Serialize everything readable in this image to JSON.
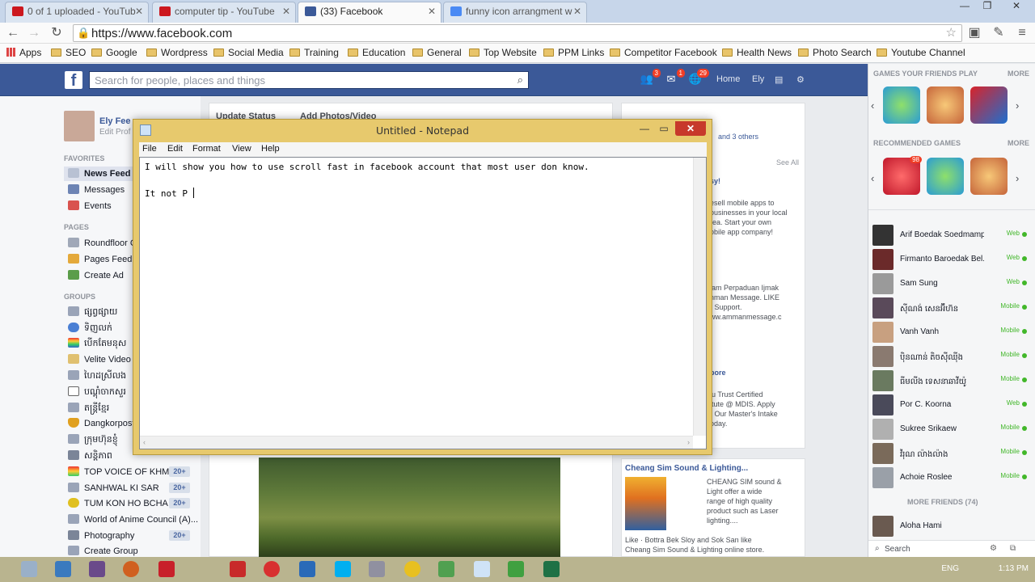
{
  "browser": {
    "tabs": [
      {
        "title": "0 of 1 uploaded - YouTub",
        "color": "#cc181e"
      },
      {
        "title": "computer tip - YouTube",
        "color": "#cc181e"
      },
      {
        "title": "(33) Facebook",
        "color": "#3b5998"
      },
      {
        "title": "funny icon arrangment w",
        "color": "#4a8af4"
      }
    ],
    "url": "https://www.facebook.com",
    "bookmarks": [
      "Apps",
      "SEO",
      "Google",
      "Wordpress",
      "Social Media",
      "Training",
      "Education",
      "General",
      "Top Website",
      "PPM Links",
      "Competitor Facebook",
      "Health News",
      "Photo Search",
      "Youtube Channel"
    ]
  },
  "facebook": {
    "search_placeholder": "Search for people, places and things",
    "badges": {
      "friends": "3",
      "messages": "1",
      "notifications": "29"
    },
    "top_links": [
      "Home",
      "Ely"
    ],
    "profile": {
      "name": "Ely Fee",
      "edit": "Edit Prof"
    },
    "sections": {
      "favorites": "FAVORITES",
      "pages": "PAGES",
      "groups": "GROUPS"
    },
    "favorites": [
      "News Feed",
      "Messages",
      "Events"
    ],
    "pages": [
      "Roundfloor C",
      "Pages Feed",
      "Create Ad"
    ],
    "groups": [
      {
        "name": "ផ្សព្វផ្សាយ",
        "count": ""
      },
      {
        "name": "ទិញលក់",
        "count": ""
      },
      {
        "name": "បើកតែមនុស",
        "count": ""
      },
      {
        "name": "Velite Video T",
        "count": ""
      },
      {
        "name": "ហៃដស្រីលង",
        "count": ""
      },
      {
        "name": "បណ្តុំចាកសួរ",
        "count": ""
      },
      {
        "name": "តន្ត្រីខ្មែរ",
        "count": ""
      },
      {
        "name": "Dangkorpost",
        "count": ""
      },
      {
        "name": "ក្រុមហ៊ុនខ្ញុំ",
        "count": ""
      },
      {
        "name": "សន្តិភាព",
        "count": ""
      },
      {
        "name": "TOP VOICE OF KHM...",
        "count": "20+"
      },
      {
        "name": "SANHWAL KI SAR",
        "count": "20+"
      },
      {
        "name": "TUM KON HO BCHA ...",
        "count": "20+"
      },
      {
        "name": "World of Anime Council (A)...",
        "count": ""
      },
      {
        "name": "Photography",
        "count": "20+"
      },
      {
        "name": "Create Group",
        "count": ""
      }
    ],
    "composer": {
      "update": "Update Status",
      "photo": "Add Photos/Video"
    },
    "right_fragments": {
      "others": "and 3 others",
      "see_all": "See All",
      "ad1_title": "sy!",
      "ad1_lines": [
        "esell mobile apps to",
        "ousinesses in your local",
        "rea. Start your own",
        "obile app company!"
      ],
      "ad2_lines": [
        "lam Perpaduan Ijmak",
        "nman Message. LIKE",
        "r Support.",
        "ww.ammanmessage.c"
      ],
      "ad3_title": "pore",
      "ad3_lines": [
        "lu Trust Certified",
        "itute @ MDIS. Apply",
        "r Our Master's Intake",
        "oday."
      ]
    },
    "sponsored": {
      "title": "Cheang Sim Sound & Lighting...",
      "lines": [
        "CHEANG SIM sound &",
        "Light offer a wide",
        "range of high quality",
        "product such as Laser",
        "lighting...."
      ],
      "like": "Like · Bottra Bek Sloy and Sok San like",
      "like2": "Cheang Sim Sound & Lighting online store."
    },
    "right": {
      "games_play": "GAMES YOUR FRIENDS PLAY",
      "more": "MORE",
      "recommended": "RECOMMENDED GAMES",
      "game_badge": "98",
      "friends": [
        {
          "name": "Arif Boedak Soedmampar",
          "status": "Web"
        },
        {
          "name": "Firmanto Baroedak Bel...",
          "status": "Web"
        },
        {
          "name": "Sam Sung",
          "status": "Web"
        },
        {
          "name": "ស៊ីណង់ សេនអ៊ីហ៊ន",
          "status": "Mobile"
        },
        {
          "name": "Vanh Vanh",
          "status": "Mobile"
        },
        {
          "name": "ប៉ិនណាន់ តិចស៊ីឈ៉ីង",
          "status": "Mobile"
        },
        {
          "name": "ធីមលីង ទេសនាឆាវីយ៉ូ",
          "status": "Mobile"
        },
        {
          "name": "Por C. Koorna",
          "status": "Web"
        },
        {
          "name": "Sukree Srikaew",
          "status": "Mobile"
        },
        {
          "name": "វីរុណ ល៉ាងល៉ាង",
          "status": "Mobile"
        },
        {
          "name": "Achoie Roslee",
          "status": "Mobile"
        }
      ],
      "more_friends": "MORE FRIENDS (74)",
      "last_friend": "Aloha Hami",
      "search": "Search"
    }
  },
  "notepad": {
    "title": "Untitled - Notepad",
    "menu": [
      "File",
      "Edit",
      "Format",
      "View",
      "Help"
    ],
    "line1": "I will show you how to use scroll fast in facebook account that most user don know.",
    "line2": "It not P"
  },
  "taskbar": {
    "lang": "ENG",
    "time": "1:13 PM"
  }
}
